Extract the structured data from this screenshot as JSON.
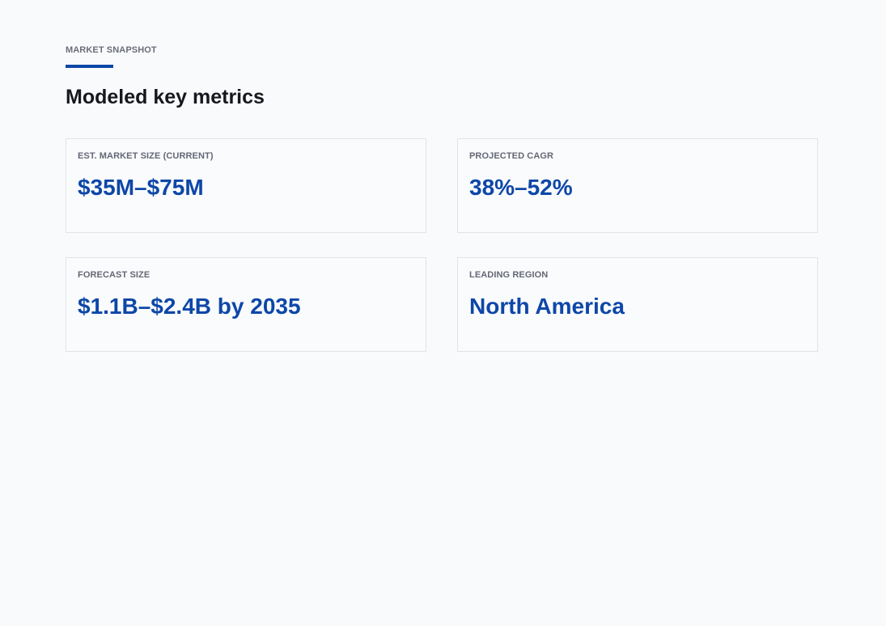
{
  "header": {
    "eyebrow": "MARKET SNAPSHOT",
    "title": "Modeled key metrics"
  },
  "colors": {
    "accent": "#0d47a8",
    "background": "#f9fafc",
    "title": "#16181d",
    "label": "#646775",
    "card_border": "#e1e3e8"
  },
  "metrics": [
    {
      "label": "EST. MARKET SIZE (CURRENT)",
      "value": "$35M–$75M"
    },
    {
      "label": "PROJECTED CAGR",
      "value": "38%–52%"
    },
    {
      "label": "FORECAST SIZE",
      "value": "$1.1B–$2.4B by 2035"
    },
    {
      "label": "LEADING REGION",
      "value": "North America"
    }
  ]
}
